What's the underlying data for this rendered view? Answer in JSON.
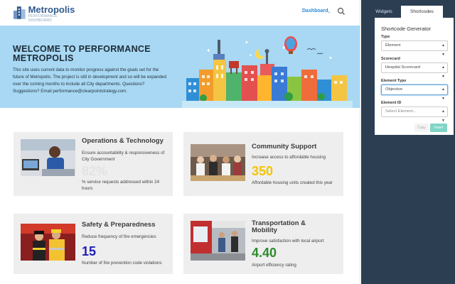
{
  "header": {
    "logo_title": "Metropolis",
    "logo_subtitle": "PERFORMANCE DASHBOARD",
    "nav_label": "Dashboard"
  },
  "hero": {
    "title": "WELCOME TO PERFORMANCE METROPOLIS",
    "text": "This site uses current data to monitor progress against the goals set for the future of Metropolis. The project is still in development and so will be expanded over the coming months to include all City departments. Questions? Suggestions? Email performance@clearpointstrategy.com."
  },
  "cards": [
    {
      "title": "Operations & Technology",
      "description": "Ensure accountability & responsiveness of City Government",
      "value": "82%",
      "value_color": "#e3e3e3",
      "note": "% service requests addressed within 24 hours"
    },
    {
      "title": "Community Support",
      "description": "Increase access to affordable housing",
      "value": "350",
      "value_color": "#f5c400",
      "note": "Affordable housing units created this year"
    },
    {
      "title": "Safety & Preparedness",
      "description": "Reduce frequency of fire emergencies",
      "value": "15",
      "value_color": "#1f1fb4",
      "note": "Number of fire prevention code violations"
    },
    {
      "title": "Transportation & Mobility",
      "description": "Improve satisfaction with local airport",
      "value": "4.40",
      "value_color": "#2e8b2e",
      "note": "Airport efficiency rating"
    }
  ],
  "sidebar": {
    "tabs": [
      "Widgets",
      "Shortcodes"
    ],
    "panel_title": "Shortcode Generator",
    "fields": [
      {
        "label": "Type",
        "value": "Element"
      },
      {
        "label": "Scorecard",
        "value": "Hospital Scorecard"
      },
      {
        "label": "Element Type",
        "value": "Objective"
      },
      {
        "label": "Element ID",
        "placeholder": "Select Element..."
      }
    ],
    "copy_label": "Copy",
    "insert_label": "Insert"
  },
  "colors": {
    "hero_bg": "#a8d8f3",
    "sidebar_bg": "#2c3e52",
    "link": "#2e8ad8",
    "insert_button": "#7fd5c6"
  }
}
